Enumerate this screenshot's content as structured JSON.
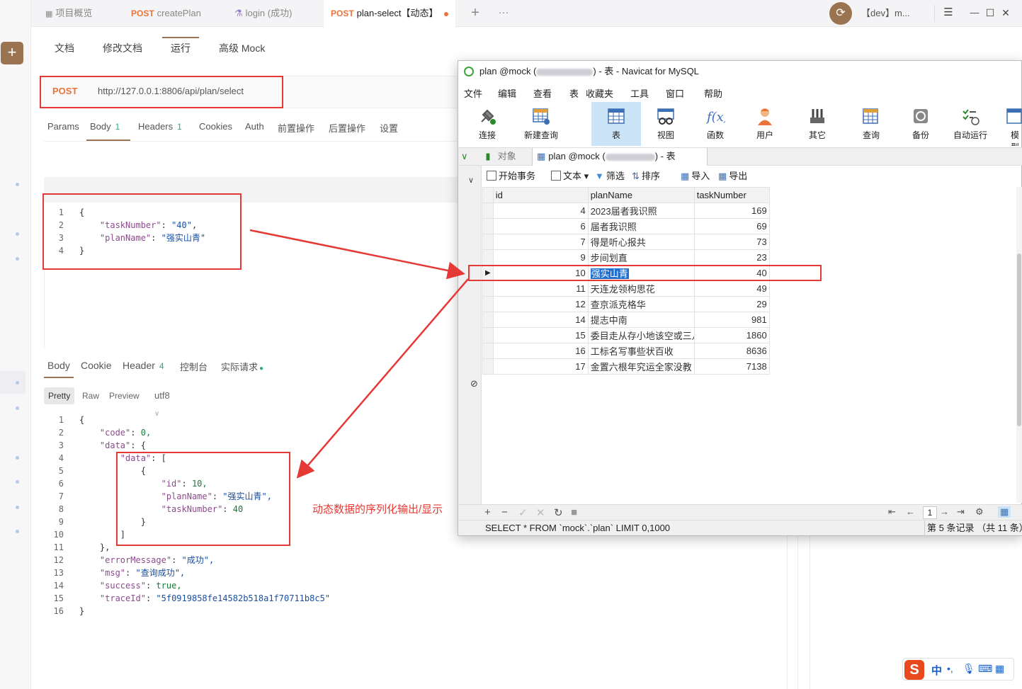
{
  "tabs": [
    {
      "method": "",
      "label": "项目概览"
    },
    {
      "method": "POST",
      "label": "createPlan"
    },
    {
      "method": "",
      "label": "login (成功)"
    },
    {
      "method": "POST",
      "label": "plan-select【动态】"
    }
  ],
  "header": {
    "env": "【dev】m...",
    "plus": "+",
    "more": "···",
    "menu": "☰",
    "min": "—",
    "max": "☐",
    "close": "✕"
  },
  "subtabs": [
    "文档",
    "修改文档",
    "运行",
    "高级 Mock"
  ],
  "request": {
    "method": "POST",
    "url": "http://127.0.0.1:8806/api/plan/select"
  },
  "request_tabs": [
    {
      "label": "Params",
      "count": ""
    },
    {
      "label": "Body",
      "count": "1"
    },
    {
      "label": "Headers",
      "count": "1"
    },
    {
      "label": "Cookies",
      "count": ""
    },
    {
      "label": "Auth",
      "count": ""
    },
    {
      "label": "前置操作",
      "count": ""
    },
    {
      "label": "后置操作",
      "count": ""
    },
    {
      "label": "设置",
      "count": ""
    }
  ],
  "request_body": {
    "lines": [
      {
        "n": "1",
        "t": "{"
      },
      {
        "n": "2",
        "k": "\"taskNumber\"",
        "v": "\"40\"",
        "end": ","
      },
      {
        "n": "3",
        "k": "\"planName\"",
        "v": "\"强实山青\"",
        "end": ""
      },
      {
        "n": "4",
        "t": "}"
      }
    ]
  },
  "response_tabs": [
    {
      "label": "Body",
      "count": ""
    },
    {
      "label": "Cookie",
      "count": ""
    },
    {
      "label": "Header",
      "count": "4"
    },
    {
      "label": "控制台",
      "count": ""
    },
    {
      "label": "实际请求",
      "count": ""
    }
  ],
  "format": {
    "pretty": "Pretty",
    "raw": "Raw",
    "preview": "Preview",
    "encoding": "utf8"
  },
  "response_body": {
    "lines": [
      "{",
      "    \"code\": 0,",
      "    \"data\": {",
      "        \"data\": [",
      "            {",
      "                \"id\": 10,",
      "                \"planName\": \"强实山青\",",
      "                \"taskNumber\": 40",
      "            }",
      "        ]",
      "    },",
      "    \"errorMessage\": \"成功\",",
      "    \"msg\": \"查询成功\",",
      "    \"success\": true,",
      "    \"traceId\": \"5f0919858fe14582b518a1f70711b8c5\"",
      "}"
    ]
  },
  "caption": "动态数据的序列化输出/显示",
  "navicat": {
    "title_pre": "plan @mock (",
    "title_post": ") - 表 - Navicat for MySQL",
    "menu": [
      "文件",
      "编辑",
      "查看",
      "表",
      "收藏夹",
      "工具",
      "窗口",
      "帮助"
    ],
    "tools": [
      "连接",
      "新建查询",
      "表",
      "视图",
      "函数",
      "用户",
      "其它",
      "查询",
      "备份",
      "自动运行",
      "模型"
    ],
    "tab_objects": "对象",
    "tab_table_pre": "plan @mock (",
    "tab_table_post": ") - 表",
    "actions": [
      "开始事务",
      "文本",
      "筛选",
      "排序",
      "导入",
      "导出"
    ],
    "columns": [
      "id",
      "planName",
      "taskNumber"
    ],
    "rows": [
      {
        "id": "4",
        "planName": "2023届者我识照",
        "taskNumber": "169"
      },
      {
        "id": "6",
        "planName": "届者我识照",
        "taskNumber": "69"
      },
      {
        "id": "7",
        "planName": "得是听心报共",
        "taskNumber": "73"
      },
      {
        "id": "9",
        "planName": "步间划直",
        "taskNumber": "23"
      },
      {
        "id": "10",
        "planName": "强实山青",
        "taskNumber": "40"
      },
      {
        "id": "11",
        "planName": "天连龙领构思花",
        "taskNumber": "49"
      },
      {
        "id": "12",
        "planName": "查京派克格华",
        "taskNumber": "29"
      },
      {
        "id": "14",
        "planName": "提志中南",
        "taskNumber": "981"
      },
      {
        "id": "15",
        "planName": "委目走从存小地该空或三八队",
        "taskNumber": "1860"
      },
      {
        "id": "16",
        "planName": "工标名写事些状百收",
        "taskNumber": "8636"
      },
      {
        "id": "17",
        "planName": "金置六根年究运全家没教",
        "taskNumber": "7138"
      }
    ],
    "page": "1",
    "sql": "SELECT * FROM `mock`.`plan` LIMIT 0,1000",
    "record": "第 5 条记录 （共 11 条）"
  },
  "ime": {
    "lang": "中",
    "punct": "•,"
  },
  "colors": {
    "accent": "#9a7450",
    "method": "#e8743b",
    "annotation": "#e53935",
    "selection": "#1f6fd1"
  }
}
